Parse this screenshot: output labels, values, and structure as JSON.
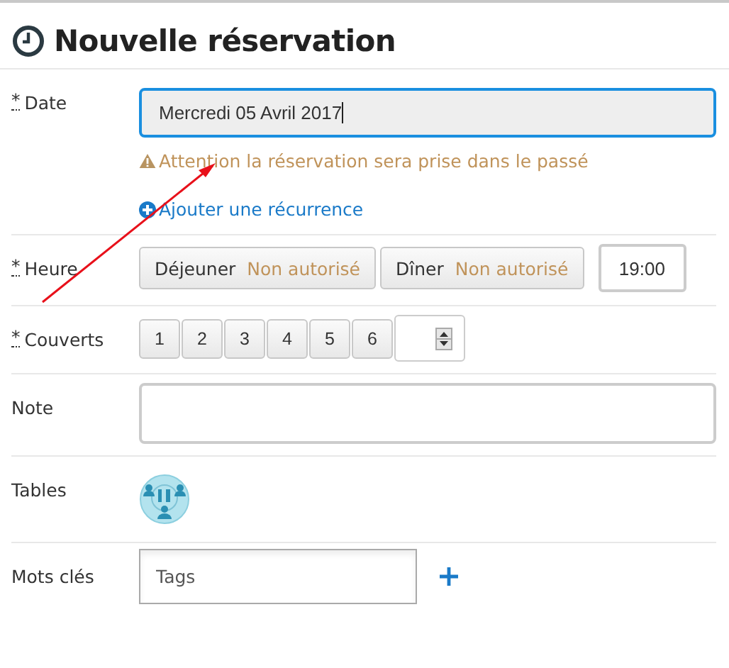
{
  "title": "Nouvelle réservation",
  "fields": [
    {
      "kind": "date",
      "label": "Date",
      "mark": "*",
      "value": "Mercredi 05 Avril 2017",
      "focused": true,
      "warning": "Attention la réservation sera prise dans le passé",
      "link": "Ajouter une récurrence"
    },
    {
      "kind": "time",
      "label": "Heure",
      "mark": "*",
      "services": [
        {
          "name": "Déjeuner",
          "status": "Non autorisé"
        },
        {
          "name": "Dîner",
          "status": "Non autorisé"
        }
      ],
      "value": "19:00"
    },
    {
      "kind": "covers",
      "label": "Couverts",
      "mark": "*",
      "options": [
        "1",
        "2",
        "3",
        "4",
        "5",
        "6"
      ]
    },
    {
      "kind": "note",
      "label": "Note"
    },
    {
      "kind": "tables",
      "label": "Tables"
    },
    {
      "kind": "tags",
      "label": "Mots clés",
      "placeholder": "Tags"
    }
  ]
}
